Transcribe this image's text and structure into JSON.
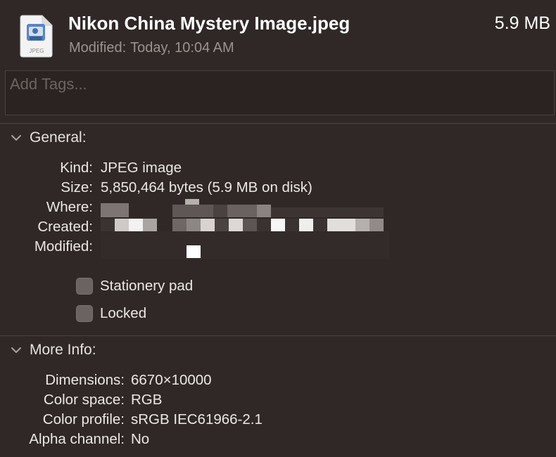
{
  "header": {
    "icon": "jpeg-file-icon",
    "icon_label": "JPEG",
    "file_name": "Nikon China Mystery Image.jpeg",
    "file_size": "5.9 MB",
    "modified_label": "Modified:",
    "modified_value": "Today, 10:04 AM"
  },
  "tags": {
    "placeholder": "Add Tags..."
  },
  "general": {
    "title": "General:",
    "rows": [
      {
        "label": "Kind:",
        "value": "JPEG image"
      },
      {
        "label": "Size:",
        "value": "5,850,464 bytes (5.9 MB on disk)"
      },
      {
        "label": "Where:",
        "value": ""
      },
      {
        "label": "Created:",
        "value": ""
      },
      {
        "label": "Modified:",
        "value": ""
      }
    ],
    "stationery_label": "Stationery pad",
    "locked_label": "Locked"
  },
  "more_info": {
    "title": "More Info:",
    "rows": [
      {
        "label": "Dimensions:",
        "value": "6670×10000"
      },
      {
        "label": "Color space:",
        "value": "RGB"
      },
      {
        "label": "Color profile:",
        "value": "sRGB IEC61966-2.1"
      },
      {
        "label": "Alpha channel:",
        "value": "No"
      }
    ]
  },
  "colors": {
    "background": "#2f2826",
    "text": "#e6e1df",
    "secondary_text": "#9b9390"
  }
}
